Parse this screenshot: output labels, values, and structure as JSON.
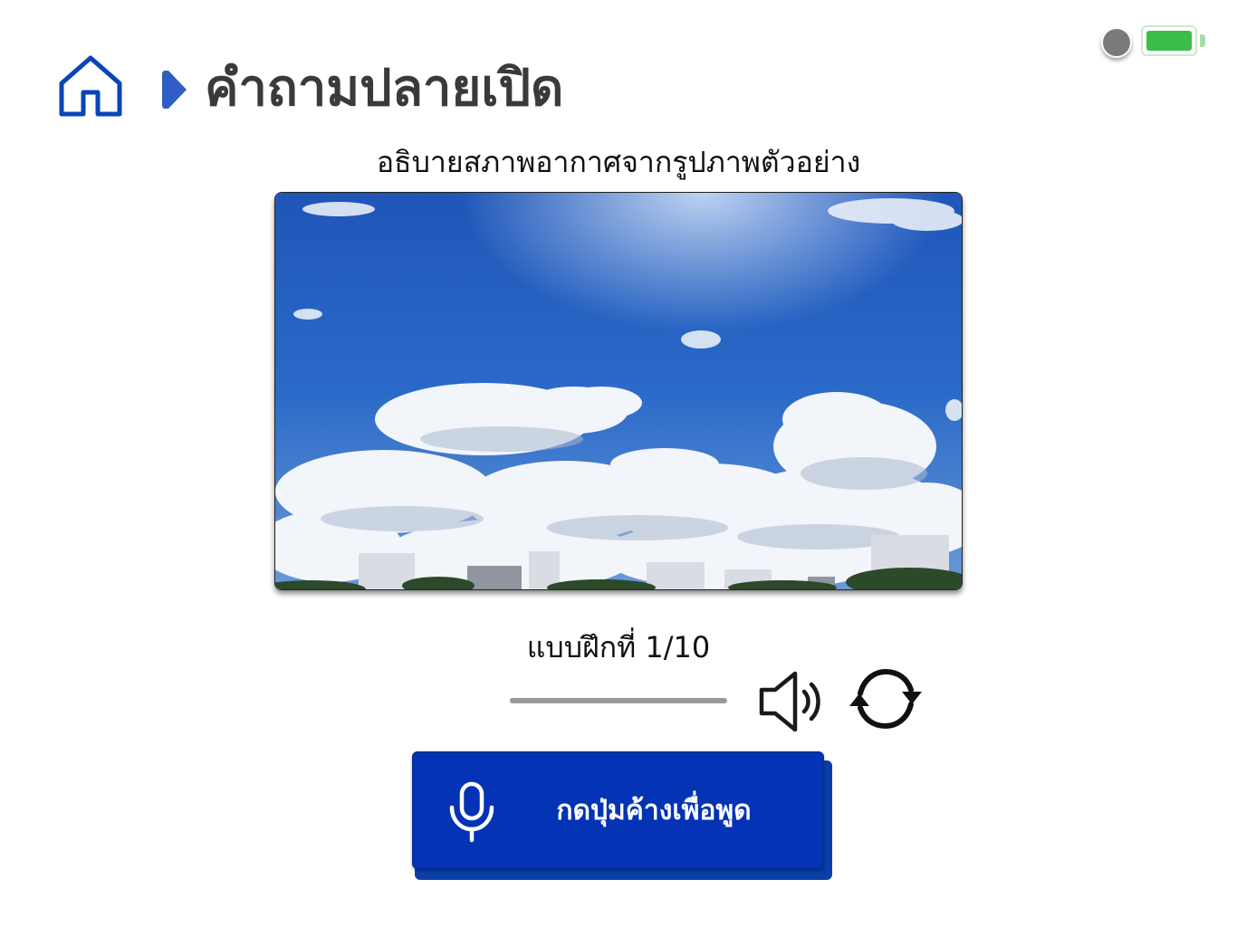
{
  "status": {
    "indicator": "record-dot-icon",
    "battery_level": 1.0,
    "battery_color": "#3bbd4a"
  },
  "header": {
    "home_icon": "home-icon",
    "separator_icon": "chevron-right-icon",
    "title": "คำถามปลายเปิด",
    "accent_color": "#0a45b8"
  },
  "question": {
    "prompt": "อธิบายสภาพอากาศจากรูปภาพตัวอย่าง",
    "image": "sky-with-clouds-photo"
  },
  "progress": {
    "label": "แบบฝึกที่ 1/10",
    "current": 1,
    "total": 10,
    "fraction": 0.1
  },
  "controls": {
    "speaker_icon": "speaker-icon",
    "refresh_icon": "refresh-icon"
  },
  "talk_button": {
    "label": "กดปุ่มค้างเพื่อพูด",
    "icon": "microphone-icon",
    "color": "#0433b5"
  }
}
